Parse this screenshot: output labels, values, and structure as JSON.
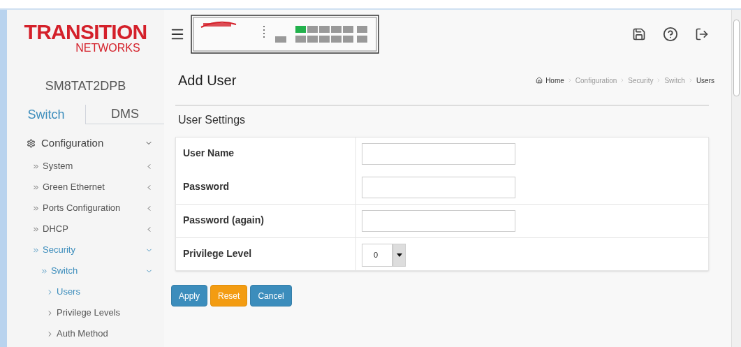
{
  "logo": {
    "brand": "TRANSITION",
    "sub": "NETWORKS"
  },
  "device_name": "SM8TAT2DPB",
  "mode_tabs": [
    {
      "label": "Switch",
      "selected": true
    },
    {
      "label": "DMS",
      "selected": false
    }
  ],
  "sidebar": {
    "label": "Configuration",
    "expanded": true,
    "items": [
      {
        "label": "System",
        "expanded": false,
        "selected": false
      },
      {
        "label": "Green Ethernet",
        "expanded": false,
        "selected": false
      },
      {
        "label": "Ports Configuration",
        "expanded": false,
        "selected": false
      },
      {
        "label": "DHCP",
        "expanded": false,
        "selected": false
      },
      {
        "label": "Security",
        "expanded": true,
        "selected": true,
        "children": [
          {
            "label": "Switch",
            "expanded": true,
            "selected": true,
            "children": [
              {
                "label": "Users",
                "selected": true
              },
              {
                "label": "Privilege Levels",
                "selected": false
              },
              {
                "label": "Auth Method",
                "selected": false
              }
            ]
          }
        ]
      }
    ]
  },
  "page_title": "Add User",
  "breadcrumb": [
    "Home",
    "Configuration",
    "Security",
    "Switch",
    "Users"
  ],
  "section_title": "User Settings",
  "fields": [
    {
      "label": "User Name",
      "kind": "text"
    },
    {
      "label": "Password",
      "kind": "text"
    },
    {
      "label": "Password (again)",
      "kind": "text"
    },
    {
      "label": "Privilege Level",
      "kind": "select",
      "value": "0"
    }
  ],
  "buttons": [
    {
      "label": "Apply",
      "kind": "primary"
    },
    {
      "label": "Reset",
      "kind": "warning"
    },
    {
      "label": "Cancel",
      "kind": "primary"
    }
  ]
}
